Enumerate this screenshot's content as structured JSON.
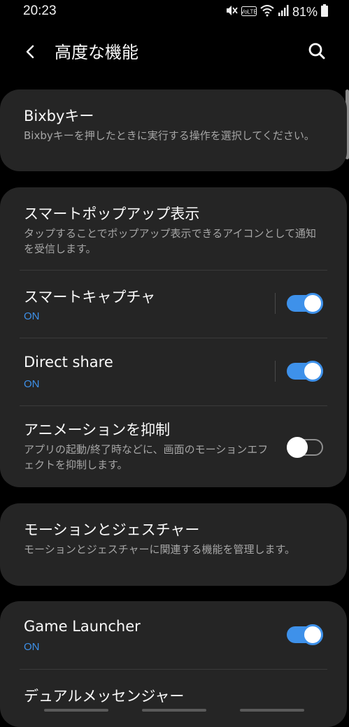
{
  "status_bar": {
    "time": "20:23",
    "battery_percent": "81%",
    "icons": [
      "mute-icon",
      "volte-icon",
      "wifi-icon",
      "signal-icon",
      "battery-icon"
    ],
    "volte_label": "VoLTE"
  },
  "app_bar": {
    "title": "高度な機能",
    "back_icon": "back-arrow-icon",
    "search_icon": "search-icon"
  },
  "colors": {
    "accent": "#3e91ea",
    "card": "#252525",
    "background": "#000000",
    "secondary_text": "#a6a6a6"
  },
  "settings": {
    "bixby": {
      "title": "Bixbyキー",
      "subtitle": "Bixbyキーを押したときに実行する操作を選択してください。"
    },
    "smart_popup": {
      "title": "スマートポップアップ表示",
      "subtitle": "タップすることでポップアップ表示できるアイコンとして通知を受信します。"
    },
    "smart_capture": {
      "title": "スマートキャプチャ",
      "status": "ON",
      "enabled": true
    },
    "direct_share": {
      "title": "Direct share",
      "status": "ON",
      "enabled": true
    },
    "reduce_animations": {
      "title": "アニメーションを抑制",
      "subtitle": "アプリの起動/終了時などに、画面のモーションエフェクトを抑制します。",
      "enabled": false
    },
    "motions": {
      "title": "モーションとジェスチャー",
      "subtitle": "モーションとジェスチャーに関連する機能を管理します。"
    },
    "game_launcher": {
      "title": "Game Launcher",
      "status": "ON",
      "enabled": true
    },
    "dual_messenger": {
      "title": "デュアルメッセンジャー"
    }
  }
}
